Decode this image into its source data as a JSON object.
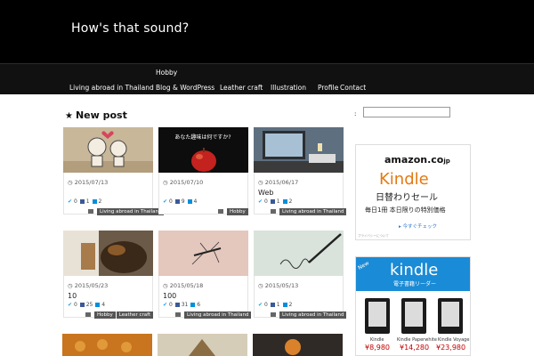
{
  "site": {
    "title": "How's that sound?"
  },
  "nav": {
    "hobby": "Hobby",
    "items": [
      "Living abroad in Thailand",
      "Blog & WordPress",
      "Leather craft",
      "Illustration",
      "Profile",
      "Contact"
    ]
  },
  "section": {
    "heading": "New post"
  },
  "posts": [
    {
      "date": "2015/07/13",
      "title": "",
      "tw": "0",
      "fb": "1",
      "hb": "2",
      "tags": [
        "Living abroad in Thailand"
      ]
    },
    {
      "date": "2015/07/10",
      "title": "",
      "tw": "0",
      "fb": "9",
      "hb": "4",
      "tags": [
        "Hobby"
      ],
      "image_text": "あなた趣味は何ですか?"
    },
    {
      "date": "2015/06/17",
      "title": "Web",
      "tw": "0",
      "fb": "1",
      "hb": "2",
      "tags": [
        "Living abroad in Thailand"
      ]
    },
    {
      "date": "2015/05/23",
      "title": "10",
      "tw": "0",
      "fb": "25",
      "hb": "4",
      "tags": [
        "Hobby",
        "Leather craft"
      ]
    },
    {
      "date": "2015/05/18",
      "title": "100",
      "tw": "0",
      "fb": "31",
      "hb": "6",
      "tags": [
        "Living abroad in Thailand"
      ]
    },
    {
      "date": "2015/05/13",
      "title": "",
      "tw": "0",
      "fb": "1",
      "hb": "2",
      "tags": [
        "Living abroad in Thailand"
      ]
    }
  ],
  "sidebar": {
    "colon": ":",
    "search_placeholder": "",
    "ad1": {
      "logo": "amazon.co",
      "logo_tld": "jp",
      "product": "Kindle",
      "line1": "日替わりセール",
      "line2": "毎日1冊 本日限りの特別価格",
      "cta": "▸ 今すぐチェック",
      "footer": "プライバシーについて"
    },
    "ad2": {
      "badge": "New",
      "brand": "kindle",
      "subtitle": "電子書籍リーダー",
      "devices": [
        {
          "name": "Kindle",
          "price": "¥8,980"
        },
        {
          "name": "Kindle Paperwhite",
          "price": "¥14,280"
        },
        {
          "name": "Kindle Voyage",
          "price": "¥23,980"
        }
      ]
    }
  },
  "colors": {
    "header_bg": "#000000",
    "nav_bg": "#111111",
    "tag_bg": "#555555",
    "amazon_orange": "#e47911",
    "kindle_blue": "#1a8bd6"
  }
}
